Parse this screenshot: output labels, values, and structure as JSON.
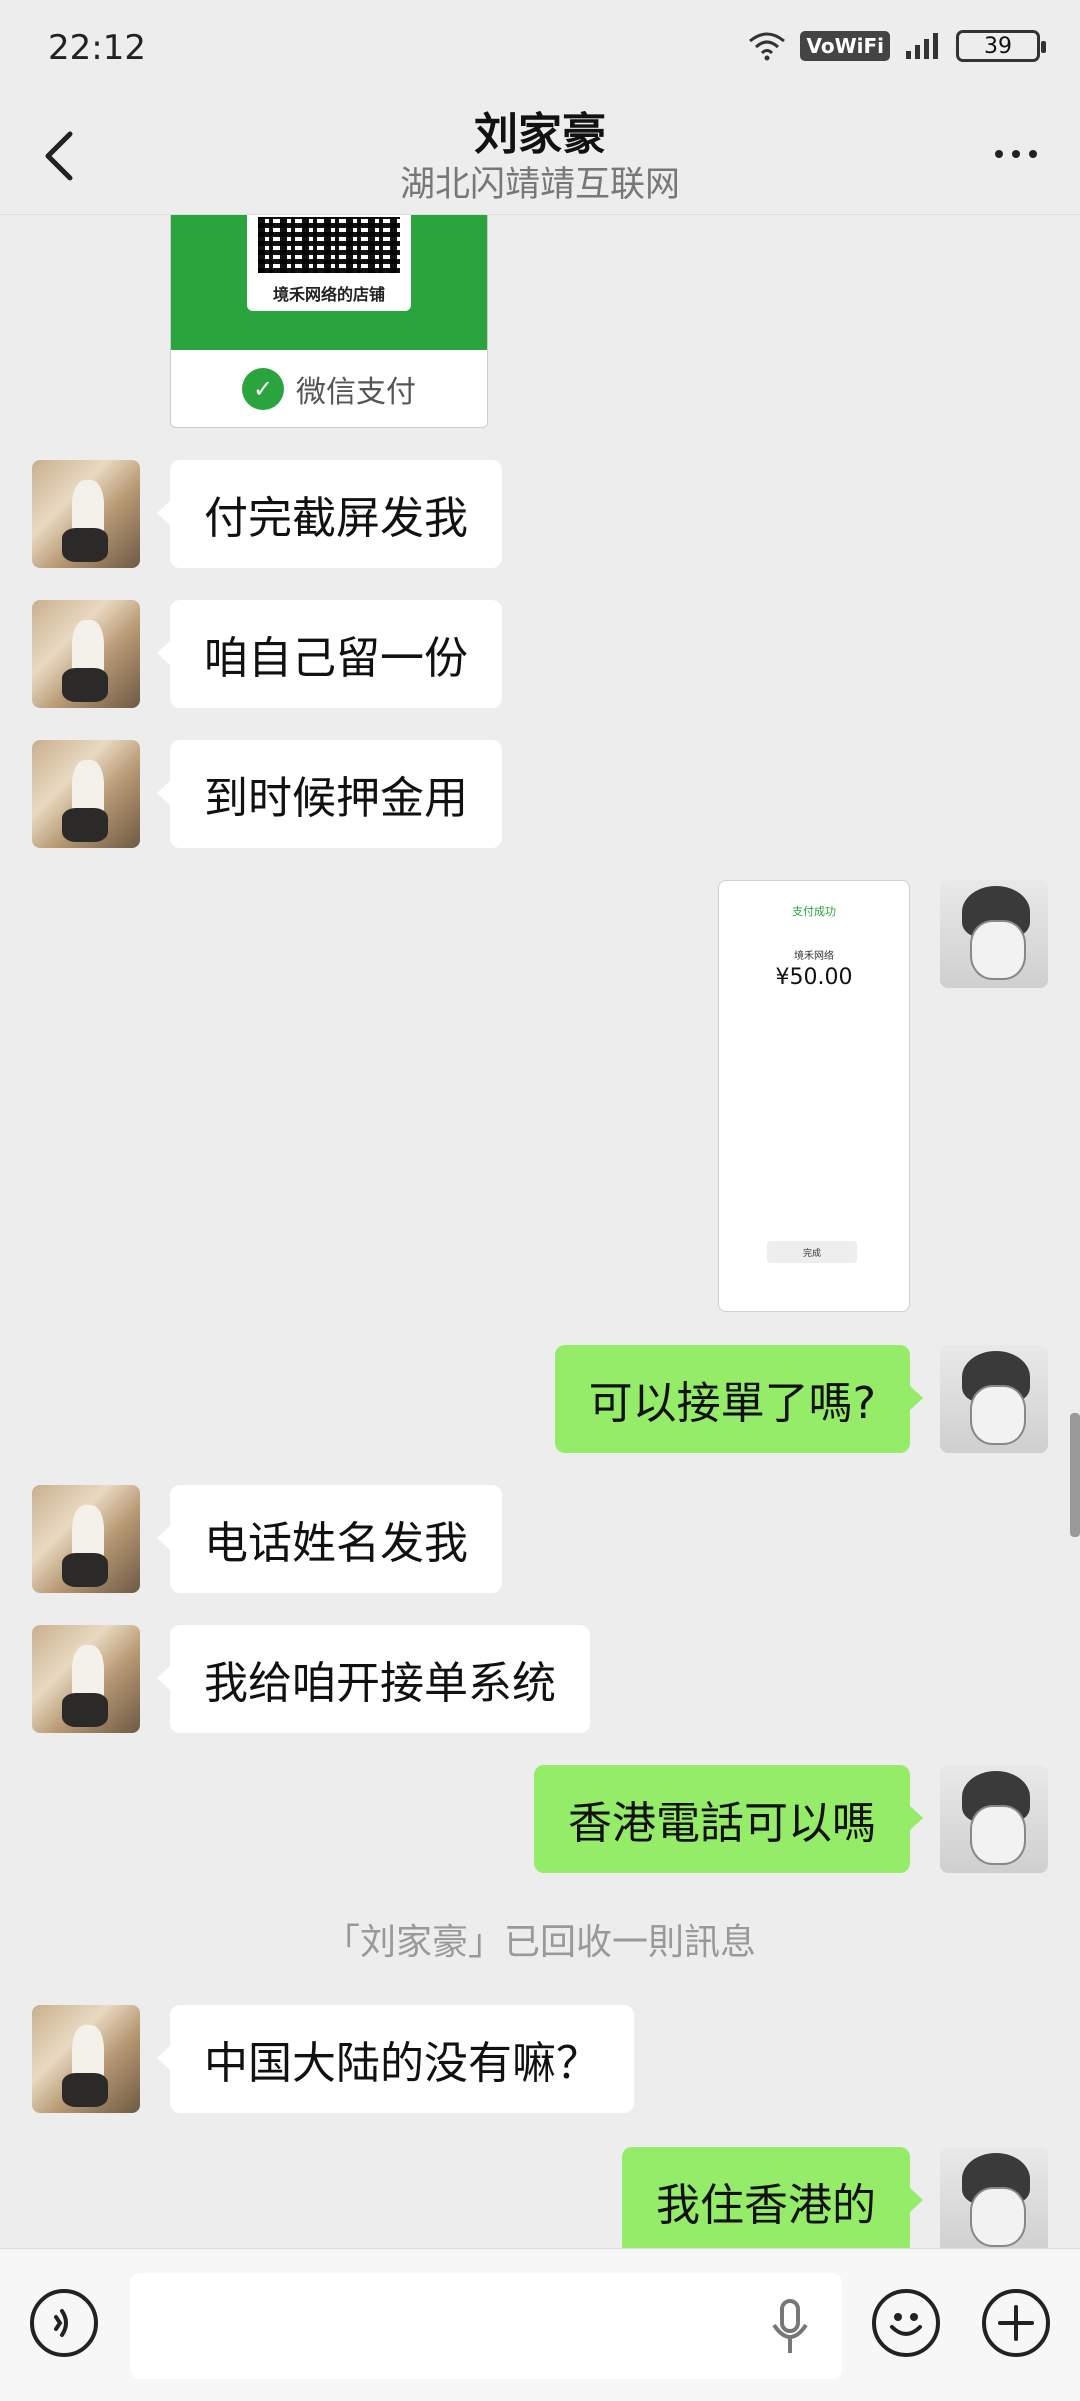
{
  "status": {
    "time": "22:12",
    "vowifi": "VoWiFi",
    "battery": "39"
  },
  "header": {
    "title": "刘家豪",
    "subtitle": "湖北闪靖靖互联网"
  },
  "payment_card": {
    "shop_name": "境禾网络的店铺",
    "pay_label": "微信支付"
  },
  "messages": {
    "m1": "付完截屏发我",
    "m2": "咱自己留一份",
    "m3": "到时候押金用",
    "screenshot": {
      "status": "支付成功",
      "merchant": "境禾网络",
      "amount": "¥50.00",
      "button": "完成"
    },
    "m4": "可以接單了嗎?",
    "m5": "电话姓名发我",
    "m6": "我给咱开接单系统",
    "m7": "香港電話可以嗎",
    "recall_note": "「刘家豪」已回收一則訊息",
    "m8": "中国大陆的没有嘛？",
    "m9": "我住香港的"
  },
  "input": {
    "placeholder": ""
  }
}
